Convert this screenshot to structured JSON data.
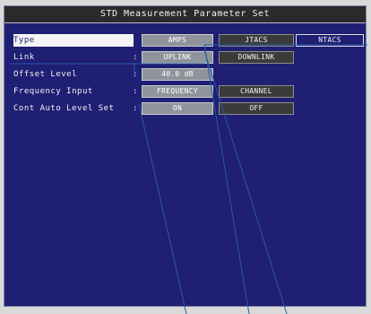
{
  "window": {
    "title": "STD Measurement Parameter Set"
  },
  "parameters": [
    {
      "label": "Type",
      "colon": ":",
      "options": [
        "AMPS",
        "JTACS",
        "NTACS"
      ],
      "selected_index": 1
    },
    {
      "label": "Link",
      "colon": ":",
      "options": [
        "UPLINK",
        "DOWNLINK"
      ],
      "selected_index": 0
    },
    {
      "label": "Offset Level",
      "colon": ":",
      "value": "40.0 dB"
    },
    {
      "label": "Frequency Input",
      "colon": ":",
      "options": [
        "FREQUENCY",
        "CHANNEL"
      ],
      "selected_index": 0
    },
    {
      "label": "Cont Auto Level Set",
      "colon": ":",
      "options": [
        "ON",
        "OFF"
      ],
      "selected_index": 1
    }
  ],
  "annotation": {
    "line_color": "#2a5aa8"
  },
  "colors": {
    "background": "#1f1f74",
    "title_bar": "#2a2a2a",
    "selected_option": "#8f949c",
    "unselected_option": "#3b3b3b"
  }
}
